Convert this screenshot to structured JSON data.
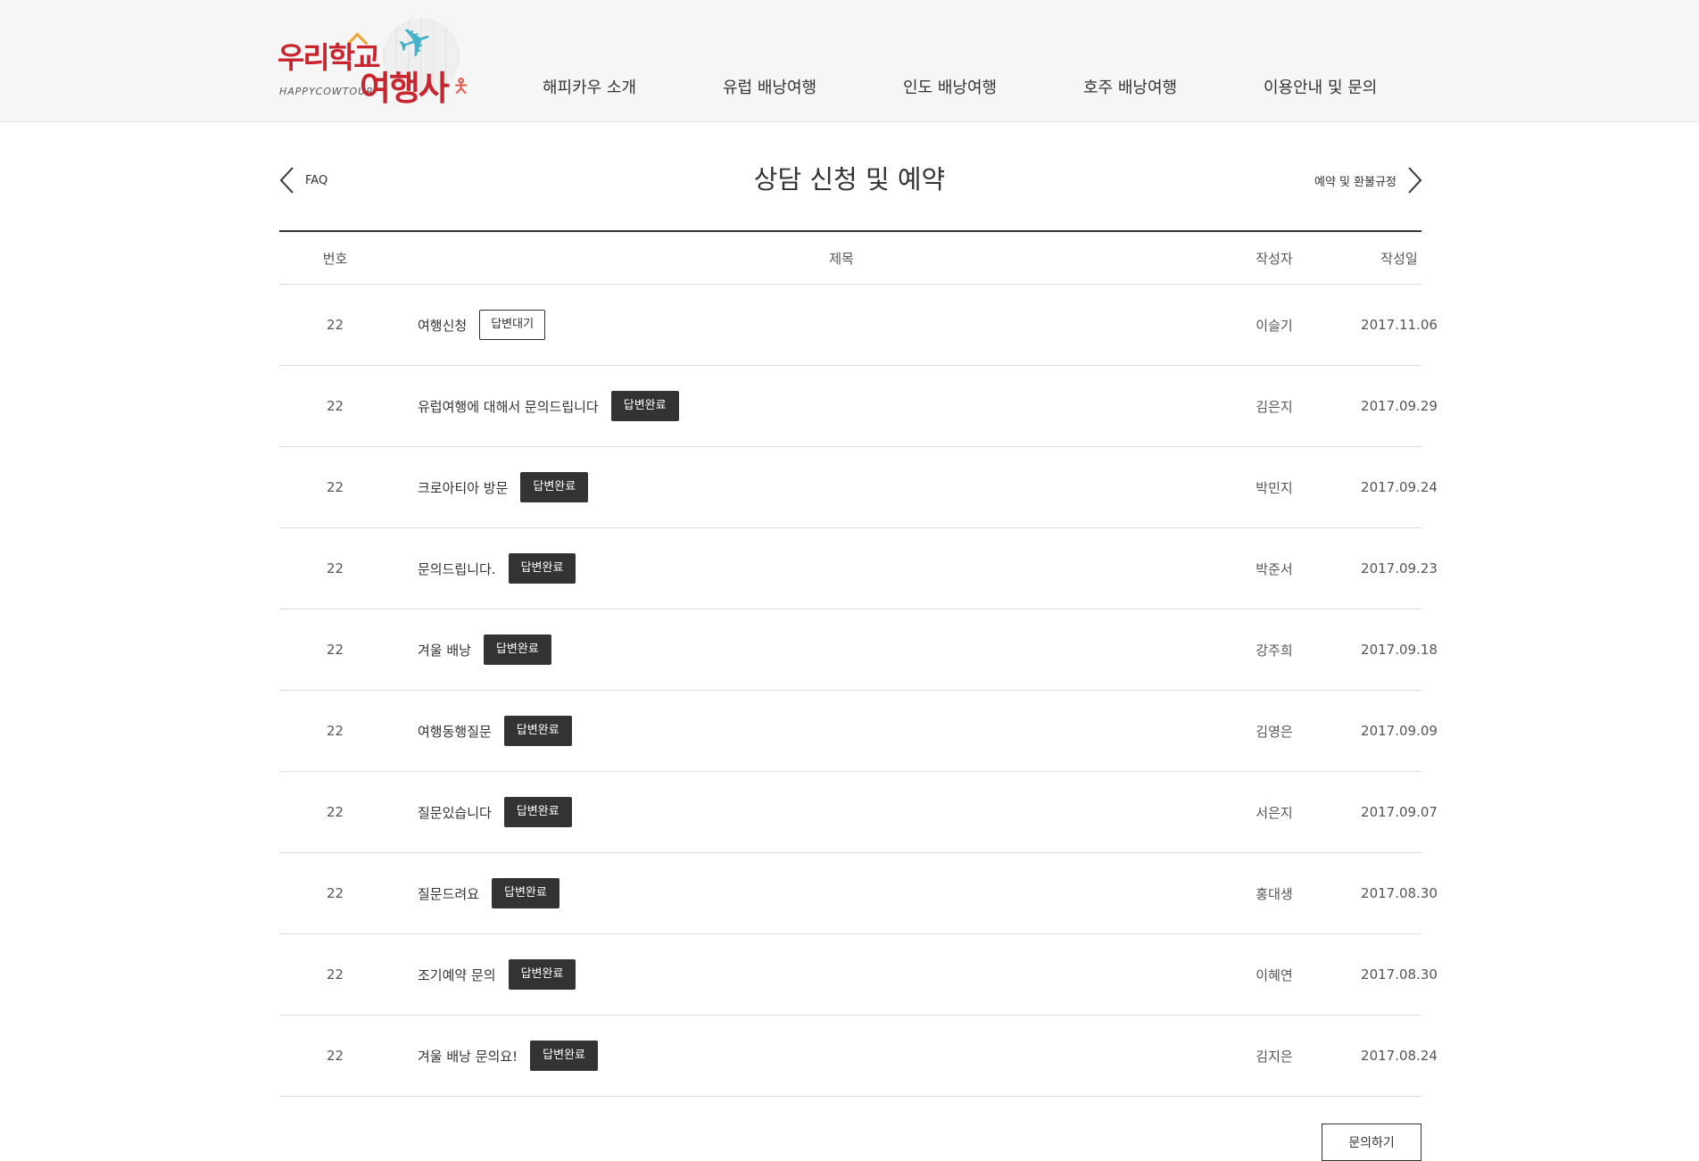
{
  "logo": {
    "title_top": "우리학교",
    "title_bottom": "여행사",
    "subtitle": "HAPPYCOWTOUR"
  },
  "nav": {
    "items": [
      {
        "label": "해피카우 소개"
      },
      {
        "label": "유럽 배낭여행"
      },
      {
        "label": "인도 배낭여행"
      },
      {
        "label": "호주 배낭여행"
      },
      {
        "label": "이용안내 및 문의"
      }
    ]
  },
  "page": {
    "prev_label": "FAQ",
    "title": "상담 신청 및 예약",
    "next_label": "예약 및 환불규정"
  },
  "table": {
    "headers": {
      "no": "번호",
      "title": "제목",
      "writer": "작성자",
      "date": "작성일"
    },
    "rows": [
      {
        "no": "22",
        "title": "여행신청",
        "status": "답변대기",
        "writer": "이슬기",
        "date": "2017.11.06"
      },
      {
        "no": "22",
        "title": "유럽여행에 대해서 문의드립니다",
        "status": "답변완료",
        "writer": "김은지",
        "date": "2017.09.29"
      },
      {
        "no": "22",
        "title": "크로아티아 방문",
        "status": "답변완료",
        "writer": "박민지",
        "date": "2017.09.24"
      },
      {
        "no": "22",
        "title": "문의드립니다.",
        "status": "답변완료",
        "writer": "박준서",
        "date": "2017.09.23"
      },
      {
        "no": "22",
        "title": "겨울 배낭",
        "status": "답변완료",
        "writer": "강주희",
        "date": "2017.09.18"
      },
      {
        "no": "22",
        "title": "여행동행질문",
        "status": "답변완료",
        "writer": "김영은",
        "date": "2017.09.09"
      },
      {
        "no": "22",
        "title": "질문있습니다",
        "status": "답변완료",
        "writer": "서은지",
        "date": "2017.09.07"
      },
      {
        "no": "22",
        "title": "질문드려요",
        "status": "답변완료",
        "writer": "홍대생",
        "date": "2017.08.30"
      },
      {
        "no": "22",
        "title": "조기예약 문의",
        "status": "답변완료",
        "writer": "이혜연",
        "date": "2017.08.30"
      },
      {
        "no": "22",
        "title": "겨울 배낭 문의요!",
        "status": "답변완료",
        "writer": "김지은",
        "date": "2017.08.24"
      }
    ]
  },
  "write_button": {
    "label": "문의하기"
  }
}
